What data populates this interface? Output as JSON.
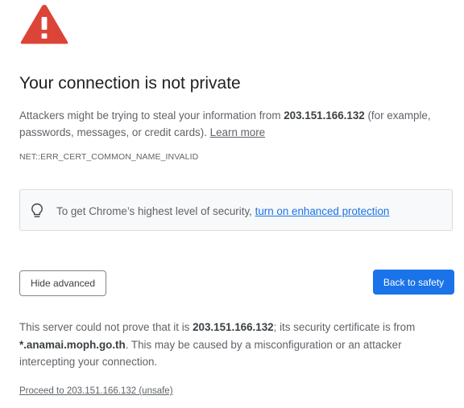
{
  "colors": {
    "warning_red": "#db4437",
    "primary_blue": "#1a73e8",
    "text_dark": "#202124",
    "text_secondary": "#5f6368",
    "box_background": "#f8f9fa"
  },
  "icons": {
    "warning": "warning-triangle-icon",
    "bulb": "lightbulb-icon"
  },
  "title": "Your connection is not private",
  "explanation": {
    "before_host": "Attackers might be trying to steal your information from ",
    "host": "203.151.166.132",
    "after_host": " (for example, passwords, messages, or credit cards). ",
    "learn_more": "Learn more"
  },
  "error_code": "NET::ERR_CERT_COMMON_NAME_INVALID",
  "enhanced_protection": {
    "text": "To get Chrome’s highest level of security, ",
    "link": "turn on enhanced protection"
  },
  "buttons": {
    "hide_advanced": "Hide advanced",
    "back_to_safety": "Back to safety"
  },
  "details": {
    "part1": "This server could not prove that it is ",
    "host": "203.151.166.132",
    "part2": "; its security certificate is from ",
    "cert_domain": "*.anamai.moph.go.th",
    "part3": ". This may be caused by a misconfiguration or an attacker intercepting your connection."
  },
  "proceed_link": "Proceed to 203.151.166.132 (unsafe)"
}
